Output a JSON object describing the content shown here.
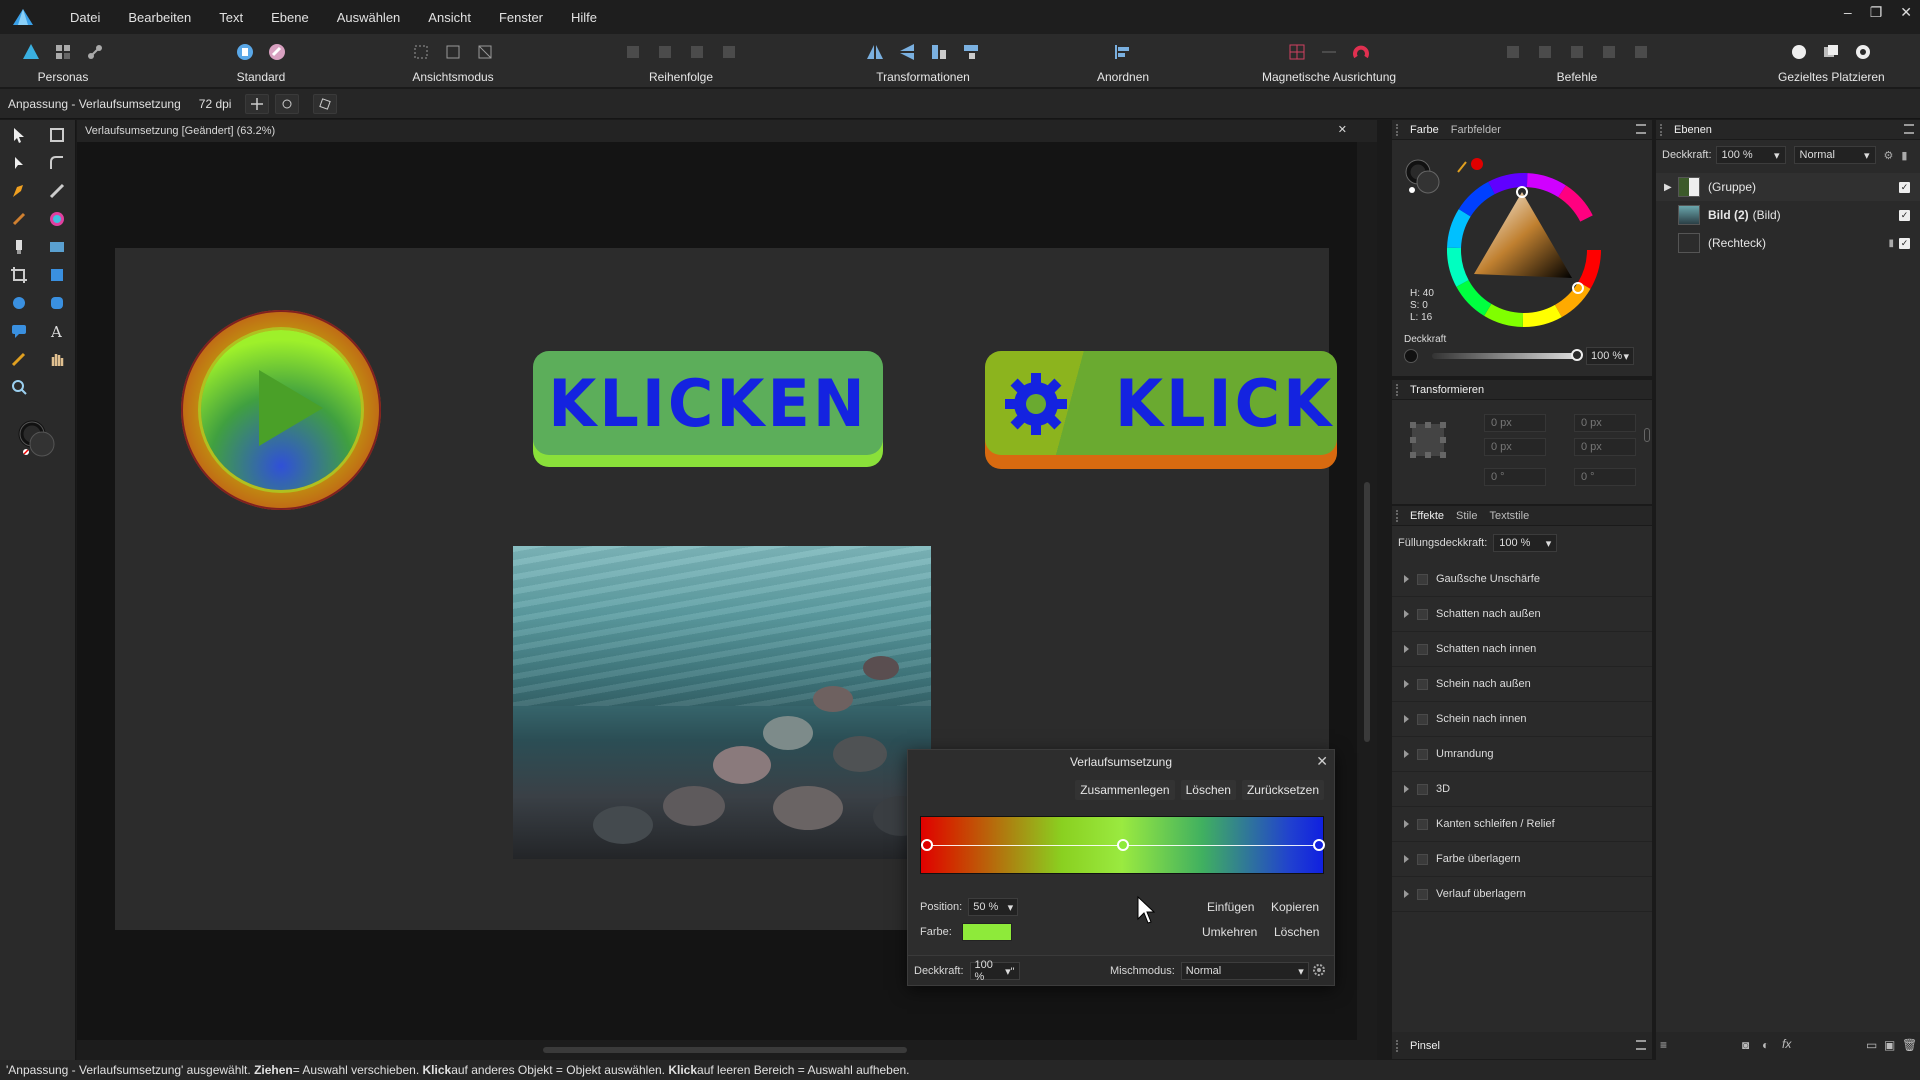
{
  "menu": [
    "Datei",
    "Bearbeiten",
    "Text",
    "Ebene",
    "Auswählen",
    "Ansicht",
    "Fenster",
    "Hilfe"
  ],
  "toolbar": {
    "personas": "Personas",
    "standard": "Standard",
    "view_mode": "Ansichtsmodus",
    "order": "Reihenfolge",
    "transformations": "Transformationen",
    "arrange": "Anordnen",
    "snapping": "Magnetische Ausrichtung",
    "operations": "Befehle",
    "placement": "Gezieltes Platzieren"
  },
  "context": {
    "label": "Anpassung - Verlaufsumsetzung",
    "dpi": "72 dpi"
  },
  "document": {
    "tab_title": "Verlaufsumsetzung [Geändert] (63.2%)"
  },
  "canvas": {
    "button_text_1": "KLICKEN",
    "button_text_2": "KLICKEN"
  },
  "gradient_map": {
    "title": "Verlaufsumsetzung",
    "merge": "Zusammenlegen",
    "delete_top": "Löschen",
    "reset": "Zurücksetzen",
    "position_label": "Position:",
    "position_value": "50 %",
    "color_label": "Farbe:",
    "color_value": "#8eea3a",
    "insert": "Einfügen",
    "copy": "Kopieren",
    "invert": "Umkehren",
    "delete_bottom": "Löschen",
    "opacity_label": "Deckkraft:",
    "opacity_value": "100 %",
    "blend_label": "Mischmodus:",
    "blend_value": "Normal",
    "stops": [
      {
        "position": 0,
        "color": "#e00000"
      },
      {
        "position": 0.5,
        "color": "#8eea3a"
      },
      {
        "position": 1,
        "color": "#1020e0"
      }
    ]
  },
  "color_panel": {
    "tab_color": "Farbe",
    "tab_swatches": "Farbfelder",
    "h": "H: 40",
    "s": "S: 0",
    "l": "L: 16",
    "opacity_label": "Deckkraft",
    "opacity_value": "100 %"
  },
  "transform_panel": {
    "title": "Transformieren",
    "x": "0 px",
    "y": "0 px",
    "w": "0 px",
    "h": "0 px",
    "r": "0 °",
    "s": "0 °"
  },
  "effects_panel": {
    "tab_effects": "Effekte",
    "tab_styles": "Stile",
    "tab_textstyles": "Textstile",
    "fill_opacity_label": "Füllungsdeckkraft:",
    "fill_opacity_value": "100 %",
    "effects": [
      "Gaußsche Unschärfe",
      "Schatten nach außen",
      "Schatten nach innen",
      "Schein nach außen",
      "Schein nach innen",
      "Umrandung",
      "3D",
      "Kanten schleifen / Relief",
      "Farbe überlagern",
      "Verlauf überlagern"
    ]
  },
  "brushes_panel": {
    "title": "Pinsel"
  },
  "layers_panel": {
    "title": "Ebenen",
    "opacity_label": "Deckkraft:",
    "opacity_value": "100 %",
    "blend_value": "Normal",
    "layers": [
      {
        "name": "(Gruppe)",
        "bold": ""
      },
      {
        "bold": "Bild (2)",
        "name": "(Bild)"
      },
      {
        "name": "(Rechteck)",
        "bold": ""
      }
    ]
  },
  "status": {
    "part1": "'Anpassung - Verlaufsumsetzung' ausgewählt. ",
    "b1": "Ziehen",
    "part2": " = Auswahl verschieben. ",
    "b2": "Klick",
    "part3": " auf anderes Objekt = Objekt auswählen. ",
    "b3": "Klick",
    "part4": " auf leeren Bereich = Auswahl aufheben."
  }
}
